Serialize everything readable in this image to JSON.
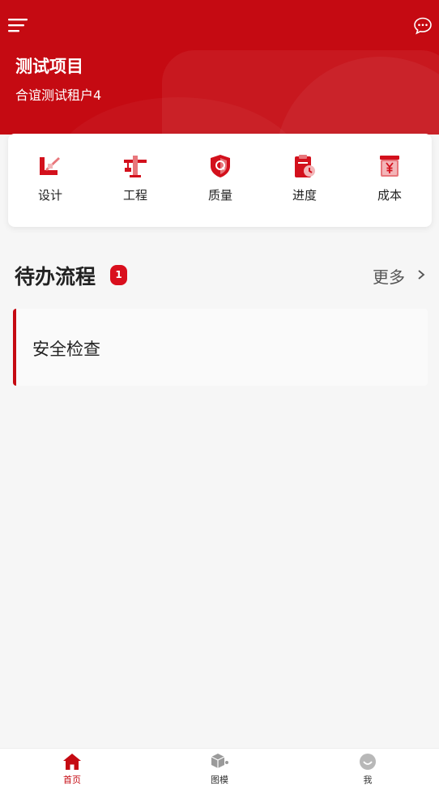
{
  "header": {
    "project_title": "测试项目",
    "tenant": "合谊测试租户4"
  },
  "modules": [
    {
      "label": "设计",
      "icon": "design-icon"
    },
    {
      "label": "工程",
      "icon": "engineering-crane-icon"
    },
    {
      "label": "质量",
      "icon": "quality-shield-icon"
    },
    {
      "label": "进度",
      "icon": "progress-clipboard-icon"
    },
    {
      "label": "成本",
      "icon": "cost-yen-icon"
    }
  ],
  "todo": {
    "title": "待办流程",
    "count": "1",
    "more_label": "更多",
    "items": [
      {
        "label": "安全检查"
      }
    ]
  },
  "tabbar": {
    "tabs": [
      {
        "label": "首页",
        "icon": "home-icon",
        "active": true
      },
      {
        "label": "图模",
        "icon": "cube-model-icon",
        "active": false
      },
      {
        "label": "我",
        "icon": "profile-icon",
        "active": false
      }
    ]
  },
  "colors": {
    "primary": "#c50a12",
    "badge": "#d90f1d",
    "background": "#f6f6f6"
  }
}
